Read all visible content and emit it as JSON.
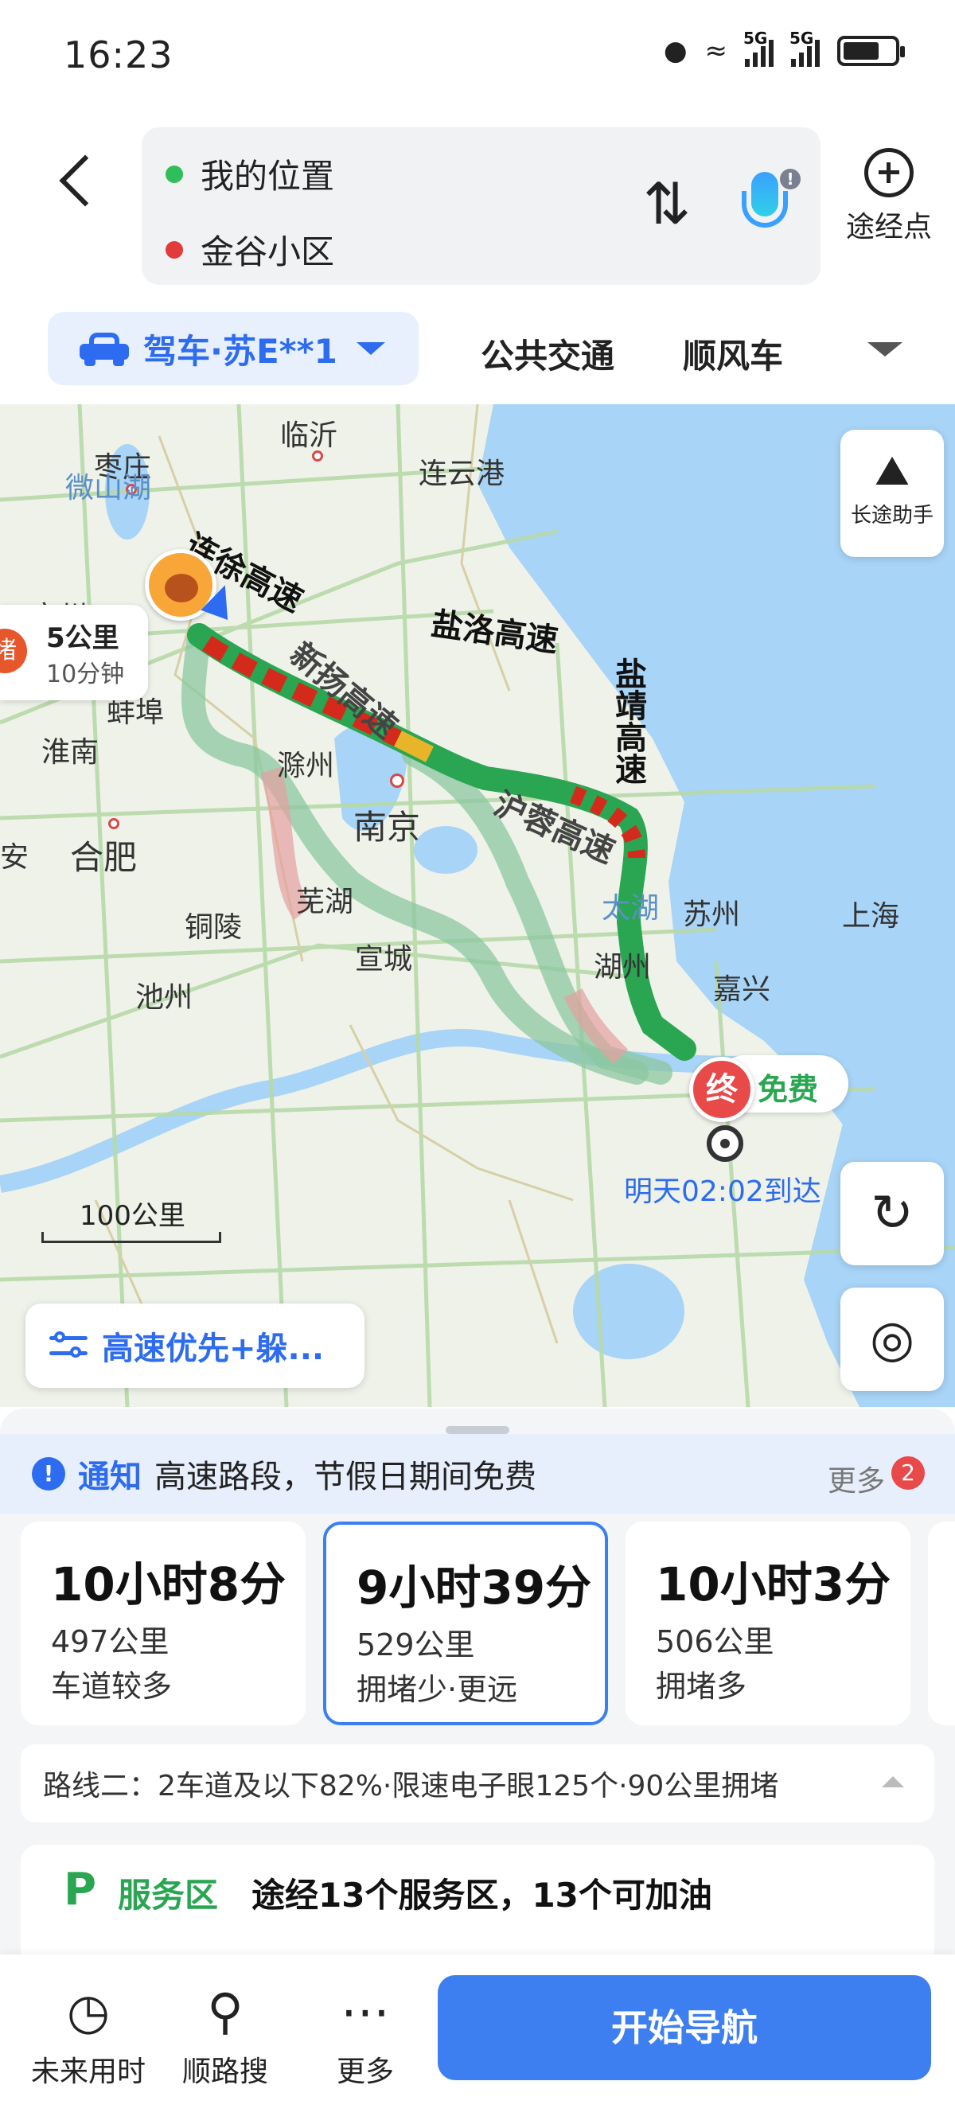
{
  "status_bar": {
    "time": "16:23",
    "icons": [
      "location-icon",
      "wifi-icon",
      "signal-5g-icon",
      "signal-5g-icon",
      "battery-charging-icon"
    ],
    "sig1_label": "5G",
    "sig2_label": "5G"
  },
  "header": {
    "origin": "我的位置",
    "destination": "金谷小区",
    "waypoint_label": "途经点"
  },
  "modes": {
    "drive": "驾车·苏E**1",
    "transit": "公共交通",
    "carpool": "顺风车"
  },
  "map": {
    "long_trip_label": "长途助手",
    "segment": {
      "stub": "堵",
      "distance": "5公里",
      "duration": "10分钟"
    },
    "toll_label": "免费",
    "end_marker": "终",
    "arrive": "明天02:02到达",
    "scale": "100公里",
    "preference": "高速优先+躲...",
    "cities": {
      "zaozhuang": "枣庄",
      "linyi": "临沂",
      "lianyungang": "连云港",
      "weishanhu": "微山湖",
      "suzhou_n": "宿州",
      "bengbu": "蚌埠",
      "huainan": "淮南",
      "chuzhou": "滁州",
      "nanjing": "南京",
      "hefei": "合肥",
      "wuhu": "芜湖",
      "tongling": "铜陵",
      "xuancheng": "宣城",
      "chizhou": "池州",
      "huzhou": "湖州",
      "jiaxing": "嘉兴",
      "taihu": "太湖",
      "suzhou_s": "苏州",
      "shanghai": "上海",
      "an": "安"
    },
    "roads": {
      "lianxu": "连徐高速",
      "yanluo": "盐洛高速",
      "yanjing": "盐靖高速",
      "xinyang": "新扬高速",
      "hurong": "沪蓉高速"
    }
  },
  "notice": {
    "title": "通知",
    "text": "高速路段，节假日期间免费",
    "more": "更多",
    "badge": "2"
  },
  "routes": [
    {
      "time": "10小时8分",
      "distance": "497公里",
      "desc": "车道较多"
    },
    {
      "time": "9小时39分",
      "distance": "529公里",
      "desc": "拥堵少·更远"
    },
    {
      "time": "10小时3分",
      "distance": "506公里",
      "desc": "拥堵多"
    }
  ],
  "route_detail": "路线二：2车道及以下82%·限速电子眼125个·90公里拥堵",
  "service": {
    "title": "服务区",
    "text": "途经13个服务区，13个可加油"
  },
  "bottom": {
    "future_time": "未来用时",
    "along_search": "顺路搜",
    "more": "更多",
    "start_nav": "开始导航"
  },
  "colors": {
    "accent": "#2d6cf0",
    "route_green": "#2aa652",
    "congestion_red": "#d42a1c",
    "toll_free": "#2aa652"
  }
}
